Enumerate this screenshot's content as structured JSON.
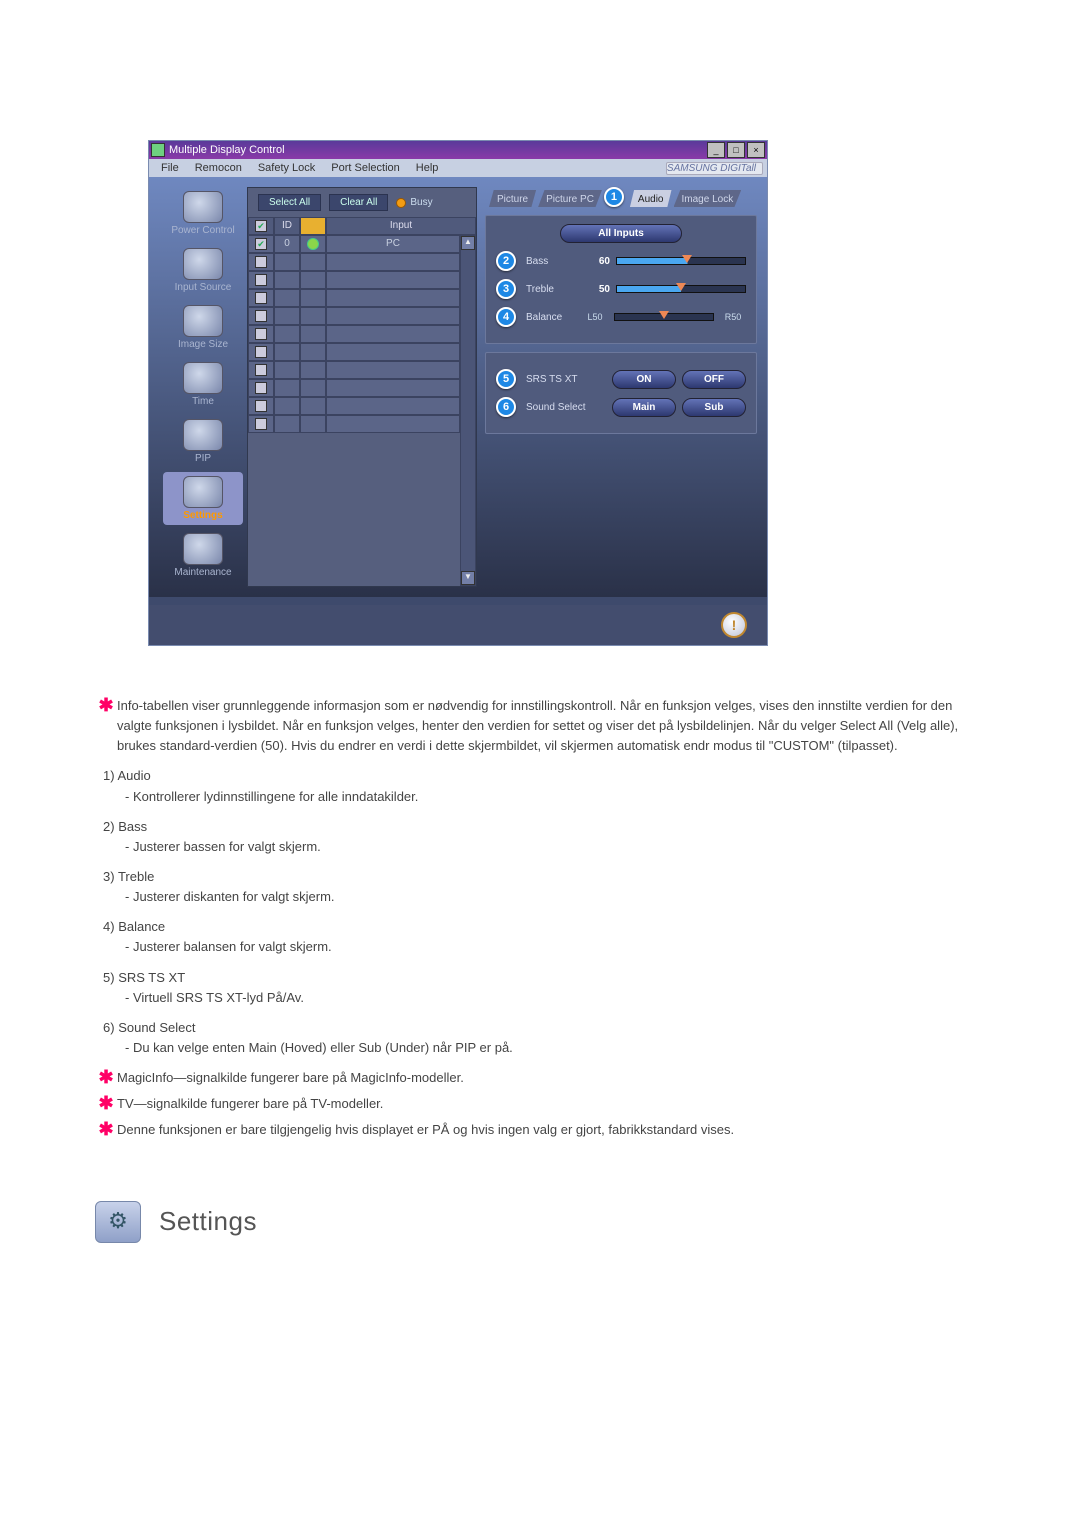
{
  "app": {
    "title": "Multiple Display Control",
    "brand": "SAMSUNG DIGITall",
    "menu": [
      "File",
      "Remocon",
      "Safety Lock",
      "Port Selection",
      "Help"
    ],
    "toolbar": {
      "select_all": "Select All",
      "clear_all": "Clear All",
      "busy": "Busy"
    },
    "list_header": {
      "chk": "",
      "id": "ID",
      "status": "",
      "input": "Input"
    },
    "rows": [
      {
        "checked": true,
        "id": "0",
        "status": "green",
        "input": "PC"
      },
      {
        "checked": false,
        "id": "",
        "status": "",
        "input": ""
      },
      {
        "checked": false,
        "id": "",
        "status": "",
        "input": ""
      },
      {
        "checked": false,
        "id": "",
        "status": "",
        "input": ""
      },
      {
        "checked": false,
        "id": "",
        "status": "",
        "input": ""
      },
      {
        "checked": false,
        "id": "",
        "status": "",
        "input": ""
      },
      {
        "checked": false,
        "id": "",
        "status": "",
        "input": ""
      },
      {
        "checked": false,
        "id": "",
        "status": "",
        "input": ""
      },
      {
        "checked": false,
        "id": "",
        "status": "",
        "input": ""
      },
      {
        "checked": false,
        "id": "",
        "status": "",
        "input": ""
      },
      {
        "checked": false,
        "id": "",
        "status": "",
        "input": ""
      }
    ],
    "sidebar": [
      "Power Control",
      "Input Source",
      "Image Size",
      "Time",
      "PIP",
      "Settings",
      "Maintenance"
    ],
    "tabs": {
      "picture": "Picture",
      "picture_pc": "Picture PC",
      "audio": "Audio",
      "image_lock": "Image Lock"
    },
    "audio_panel": {
      "header": "All Inputs",
      "bass": {
        "label": "Bass",
        "value": "60"
      },
      "treble": {
        "label": "Treble",
        "value": "50"
      },
      "balance": {
        "label": "Balance",
        "left": "L50",
        "right": "R50"
      },
      "srs": {
        "label": "SRS TS XT",
        "on": "ON",
        "off": "OFF"
      },
      "sound": {
        "label": "Sound Select",
        "main": "Main",
        "sub": "Sub"
      }
    },
    "badges": {
      "b1": "1",
      "b2": "2",
      "b3": "3",
      "b4": "4",
      "b5": "5",
      "b6": "6"
    }
  },
  "doc": {
    "intro": "Info-tabellen viser grunnleggende informasjon som er nødvendig for innstillingskontroll. Når en funksjon velges, vises den innstilte verdien for den valgte funksjonen i lysbildet. Når en funksjon velges, henter den verdien for settet og viser det på lysbildelinjen. Når du velger Select All (Velg alle), brukes standard-verdien (50). Hvis du endrer en verdi i dette skjermbildet, vil skjermen automatisk endr modus til \"CUSTOM\" (tilpasset).",
    "items": [
      {
        "num": "1)",
        "title": "Audio",
        "desc": "- Kontrollerer lydinnstillingene for alle inndatakilder."
      },
      {
        "num": "2)",
        "title": "Bass",
        "desc": "- Justerer bassen for valgt skjerm."
      },
      {
        "num": "3)",
        "title": "Treble",
        "desc": "- Justerer diskanten for valgt skjerm."
      },
      {
        "num": "4)",
        "title": "Balance",
        "desc": "- Justerer balansen for valgt skjerm."
      },
      {
        "num": "5)",
        "title": "SRS TS XT",
        "desc": "- Virtuell SRS TS XT-lyd På/Av."
      },
      {
        "num": "6)",
        "title": "Sound Select",
        "desc": "- Du kan velge enten Main (Hoved) eller Sub (Under) når PIP er på."
      }
    ],
    "notes": [
      "MagicInfo—signalkilde fungerer bare på MagicInfo-modeller.",
      "TV—signalkilde fungerer bare på TV-modeller.",
      "Denne funksjonen er bare tilgjengelig hvis displayet er PÅ og hvis ingen valg er gjort, fabrikkstandard vises."
    ],
    "section_title": "Settings"
  }
}
